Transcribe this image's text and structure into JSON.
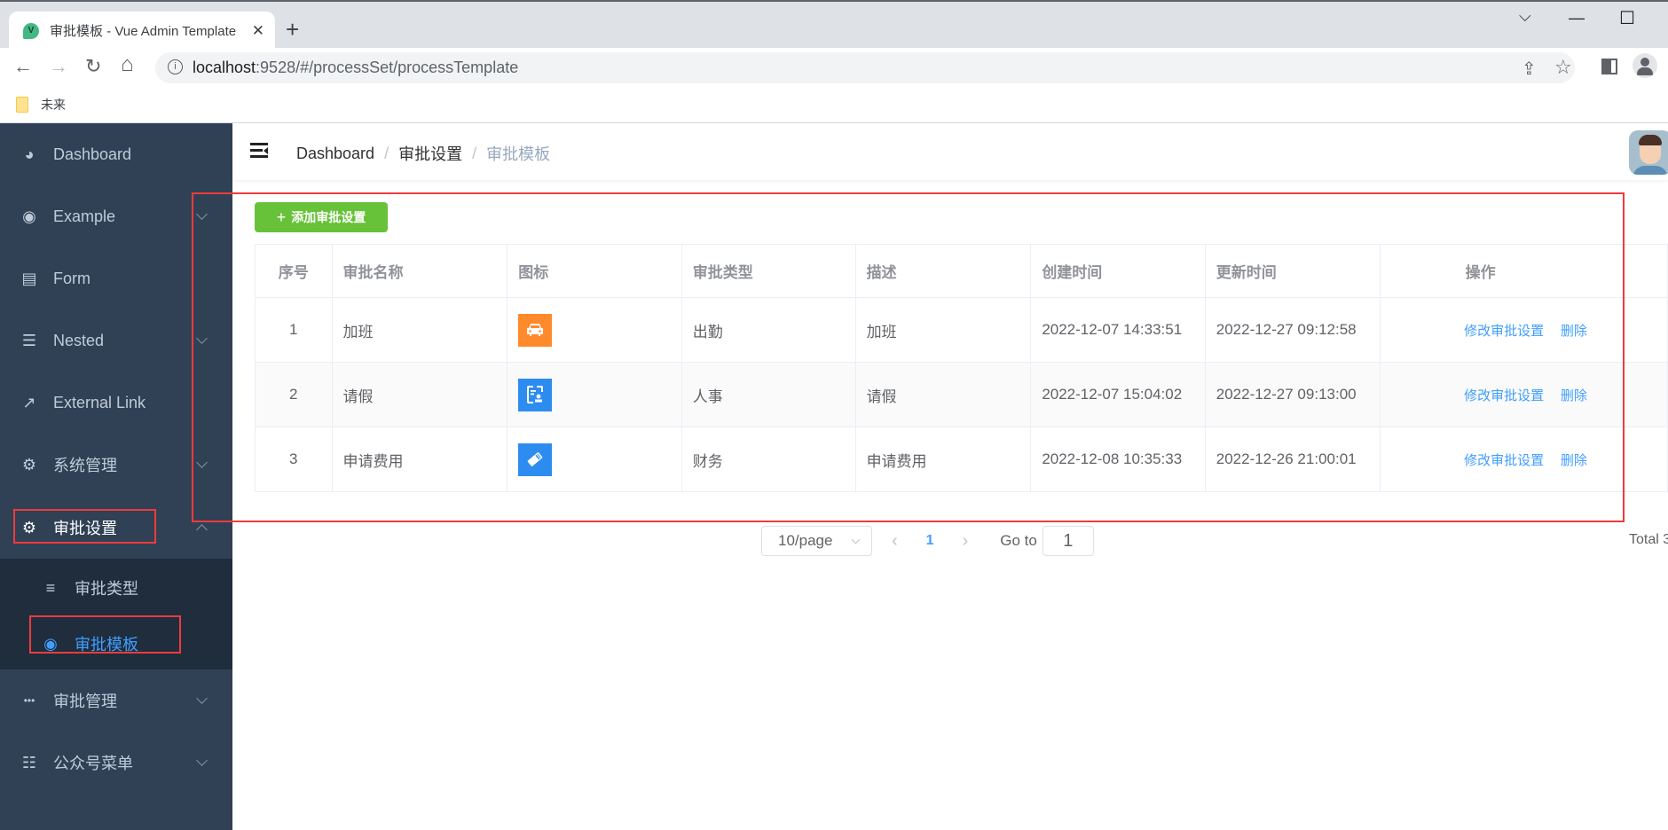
{
  "browser": {
    "tab_title": "审批模板 - Vue Admin Template",
    "favicon_letter": "V",
    "url_host": "localhost",
    "url_path": ":9528/#/processSet/processTemplate",
    "bookmark": "未来",
    "icons": {
      "back": "←",
      "forward": "→",
      "reload": "↻",
      "home": "⌂",
      "share": "⇪",
      "star": "☆",
      "close": "✕",
      "new_tab": "+",
      "chevron": "⌵",
      "minimize": "—",
      "maximize": "☐"
    }
  },
  "sidebar": {
    "items": [
      {
        "label": "Dashboard",
        "icon": "dashboard-icon",
        "glyph": "◕"
      },
      {
        "label": "Example",
        "icon": "example-icon",
        "glyph": "◉"
      },
      {
        "label": "Form",
        "icon": "form-icon",
        "glyph": "▤"
      },
      {
        "label": "Nested",
        "icon": "nested-icon",
        "glyph": "☰"
      },
      {
        "label": "External Link",
        "icon": "external-link-icon",
        "glyph": "↗"
      },
      {
        "label": "系统管理",
        "icon": "gear-icon",
        "glyph": "⚙"
      },
      {
        "label": "审批设置",
        "icon": "settings-icon",
        "glyph": "⚙"
      },
      {
        "label": "审批管理",
        "icon": "more-icon",
        "glyph": "•••"
      },
      {
        "label": "公众号菜单",
        "icon": "sliders-icon",
        "glyph": "☷"
      }
    ],
    "submenu": [
      {
        "label": "审批类型",
        "icon": "list-icon",
        "glyph": "≡"
      },
      {
        "label": "审批模板",
        "icon": "template-icon",
        "glyph": "◉",
        "active": true
      }
    ]
  },
  "navbar": {
    "breadcrumb": [
      "Dashboard",
      "审批设置",
      "审批模板"
    ],
    "separator": "/"
  },
  "toolbar": {
    "add_label": "添加审批设置",
    "add_icon": "+"
  },
  "table": {
    "headers": [
      "序号",
      "审批名称",
      "图标",
      "审批类型",
      "描述",
      "创建时间",
      "更新时间",
      "操作"
    ],
    "rows": [
      {
        "index": "1",
        "name": "加班",
        "icon": "car-icon",
        "icon_color": "#ff8a2b",
        "type": "出勤",
        "desc": "加班",
        "created": "2022-12-07 14:33:51",
        "updated": "2022-12-27 09:12:58"
      },
      {
        "index": "2",
        "name": "请假",
        "icon": "id-card-icon",
        "icon_color": "#2d8cf0",
        "type": "人事",
        "desc": "请假",
        "created": "2022-12-07 15:04:02",
        "updated": "2022-12-27 09:13:00"
      },
      {
        "index": "3",
        "name": "申请费用",
        "icon": "money-icon",
        "icon_color": "#2d8cf0",
        "type": "财务",
        "desc": "申请费用",
        "created": "2022-12-08 10:35:33",
        "updated": "2022-12-26 21:00:01"
      }
    ],
    "actions": {
      "edit": "修改审批设置",
      "delete": "删除"
    }
  },
  "pagination": {
    "page_size": "10/page",
    "current_page": "1",
    "goto_label": "Go to",
    "goto_value": "1",
    "total": "Total 3",
    "prev": "‹",
    "next": "›"
  }
}
